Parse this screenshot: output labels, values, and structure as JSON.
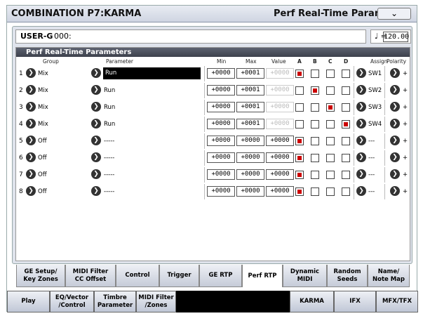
{
  "title": {
    "left": "COMBINATION P7:KARMA",
    "right": "Perf Real-Time Parameters",
    "dropdown_icon": "chevron-down-icon"
  },
  "program": {
    "bank": "USER-G",
    "number": "000:"
  },
  "tempo": {
    "symbol": "♩ =",
    "value": "120.00"
  },
  "section_title": "Perf Real-Time Parameters",
  "headers": {
    "group": "Group",
    "parameter": "Parameter",
    "min": "Min",
    "max": "Max",
    "value": "Value",
    "a": "A",
    "b": "B",
    "c": "C",
    "d": "D",
    "assign": "Assign",
    "polarity": "Polarity"
  },
  "rows": [
    {
      "num": "1",
      "group": "Mix",
      "param": "Run",
      "min": "+0000",
      "max": "+0001",
      "value": "+0000",
      "a": true,
      "b": false,
      "c": false,
      "d": false,
      "assign": "SW1",
      "polarity": "+"
    },
    {
      "num": "2",
      "group": "Mix",
      "param": "Run",
      "min": "+0000",
      "max": "+0001",
      "value": "+0000",
      "a": false,
      "b": true,
      "c": false,
      "d": false,
      "assign": "SW2",
      "polarity": "+"
    },
    {
      "num": "3",
      "group": "Mix",
      "param": "Run",
      "min": "+0000",
      "max": "+0001",
      "value": "+0000",
      "a": false,
      "b": false,
      "c": true,
      "d": false,
      "assign": "SW3",
      "polarity": "+"
    },
    {
      "num": "4",
      "group": "Mix",
      "param": "Run",
      "min": "+0000",
      "max": "+0001",
      "value": "+0000",
      "a": false,
      "b": false,
      "c": false,
      "d": true,
      "assign": "SW4",
      "polarity": "+"
    },
    {
      "num": "5",
      "group": "Off",
      "param": "-----",
      "min": "+0000",
      "max": "+0000",
      "value": "+0000",
      "a": true,
      "b": false,
      "c": false,
      "d": false,
      "assign": "---",
      "polarity": "+"
    },
    {
      "num": "6",
      "group": "Off",
      "param": "-----",
      "min": "+0000",
      "max": "+0000",
      "value": "+0000",
      "a": true,
      "b": false,
      "c": false,
      "d": false,
      "assign": "---",
      "polarity": "+"
    },
    {
      "num": "7",
      "group": "Off",
      "param": "-----",
      "min": "+0000",
      "max": "+0000",
      "value": "+0000",
      "a": true,
      "b": false,
      "c": false,
      "d": false,
      "assign": "---",
      "polarity": "+"
    },
    {
      "num": "8",
      "group": "Off",
      "param": "-----",
      "min": "+0000",
      "max": "+0000",
      "value": "+0000",
      "a": true,
      "b": false,
      "c": false,
      "d": false,
      "assign": "---",
      "polarity": "+"
    }
  ],
  "tabs_top": [
    {
      "label": "GE Setup/\nKey Zones"
    },
    {
      "label": "MIDI Filter\nCC Offset"
    },
    {
      "label": "Control"
    },
    {
      "label": "Trigger"
    },
    {
      "label": "GE RTP"
    },
    {
      "label": "Perf RTP",
      "active": true
    },
    {
      "label": "Dynamic\nMIDI"
    },
    {
      "label": "Random\nSeeds"
    },
    {
      "label": "Name/\nNote Map"
    }
  ],
  "tabs_bottom": [
    {
      "label": "Play"
    },
    {
      "label": "EQ/Vector\n/Control"
    },
    {
      "label": "Timbre\nParameter"
    },
    {
      "label": "MIDI Filter\n/Zones"
    },
    {
      "label": "KARMA"
    },
    {
      "label": "IFX"
    },
    {
      "label": "MFX/TFX"
    }
  ]
}
